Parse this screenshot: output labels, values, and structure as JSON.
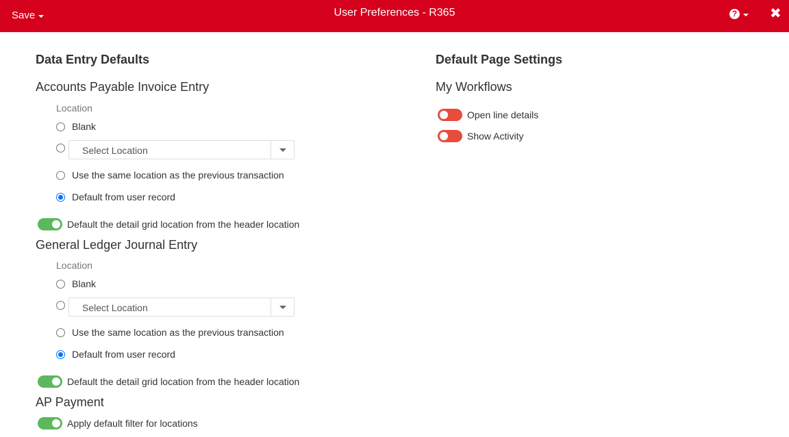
{
  "header": {
    "save_label": "Save",
    "title": "User Preferences - R365",
    "help_icon": "?",
    "close_icon": "✖"
  },
  "left": {
    "section_title": "Data Entry Defaults",
    "ap_invoice": {
      "title": "Accounts Payable Invoice Entry",
      "location_label": "Location",
      "opt_blank": "Blank",
      "select_placeholder": "Select Location",
      "opt_previous": "Use the same location as the previous transaction",
      "opt_user_record": "Default from user record",
      "selected": "user_record",
      "toggle_label": "Default the detail grid location from the header location",
      "toggle_on": true
    },
    "gl_journal": {
      "title": "General Ledger Journal Entry",
      "location_label": "Location",
      "opt_blank": "Blank",
      "select_placeholder": "Select Location",
      "opt_previous": "Use the same location as the previous transaction",
      "opt_user_record": "Default from user record",
      "selected": "user_record",
      "toggle_label": "Default the detail grid location from the header location",
      "toggle_on": true
    },
    "ap_payment": {
      "title": "AP Payment",
      "toggle_label": "Apply default filter for locations",
      "toggle_on": true
    }
  },
  "right": {
    "section_title": "Default Page Settings",
    "workflows": {
      "title": "My Workflows",
      "open_line_details_label": "Open line details",
      "open_line_details_on": false,
      "show_activity_label": "Show Activity",
      "show_activity_on": false
    }
  },
  "colors": {
    "brand_red": "#d5001c",
    "toggle_on": "#5cb85c",
    "toggle_off": "#e84c3d",
    "radio_checked": "#0075ff"
  }
}
